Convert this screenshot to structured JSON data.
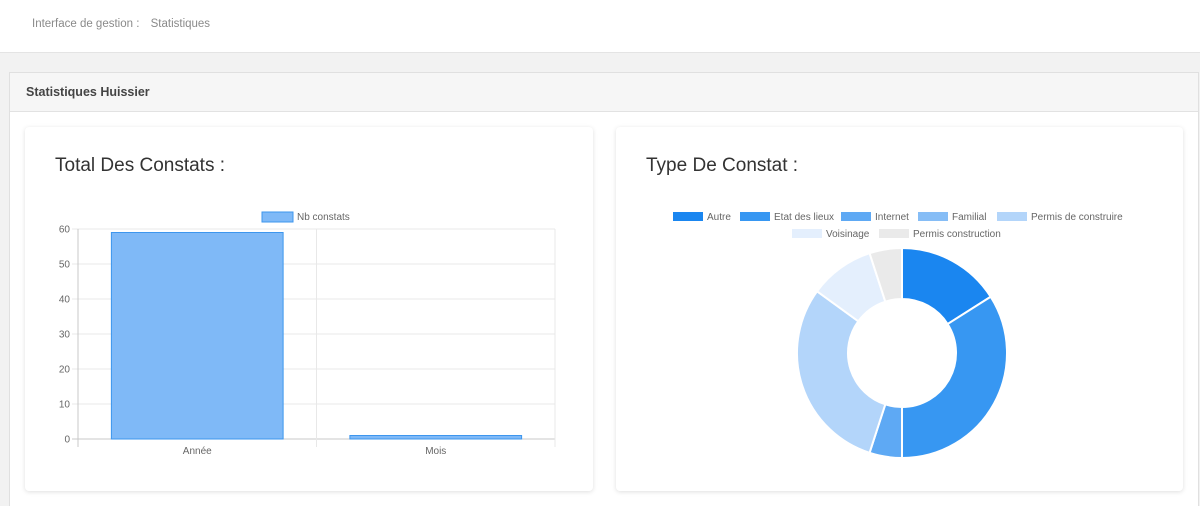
{
  "header": {
    "breadcrumb_prefix": "Interface de gestion :",
    "breadcrumb_page": "Statistiques"
  },
  "panel": {
    "title": "Statistiques Huissier"
  },
  "cards": {
    "left_title": "Total Des Constats :",
    "right_title": "Type De Constat :"
  },
  "colors": {
    "bar_fill": "#7fb9f7",
    "bar_stroke": "#3d96ee"
  },
  "chart_data": [
    {
      "type": "bar",
      "categories": [
        "Année",
        "Mois"
      ],
      "series": [
        {
          "name": "Nb constats",
          "values": [
            59,
            1
          ]
        }
      ],
      "ylim": [
        0,
        60
      ],
      "yticks": [
        0,
        10,
        20,
        30,
        40,
        50,
        60
      ],
      "grid": true,
      "legend": "top"
    },
    {
      "type": "pie",
      "variant": "doughnut",
      "labels": [
        "Autre",
        "Etat des lieux",
        "Internet",
        "Familial",
        "Permis de construire",
        "Voisinage",
        "Permis construction"
      ],
      "values": [
        16,
        34,
        5,
        0,
        30,
        10,
        5
      ],
      "colors": [
        "#1a86f0",
        "#3797f2",
        "#5ea9f4",
        "#86bdf6",
        "#b3d5fa",
        "#e4effd",
        "#eaeaea"
      ],
      "legend": "top"
    }
  ]
}
